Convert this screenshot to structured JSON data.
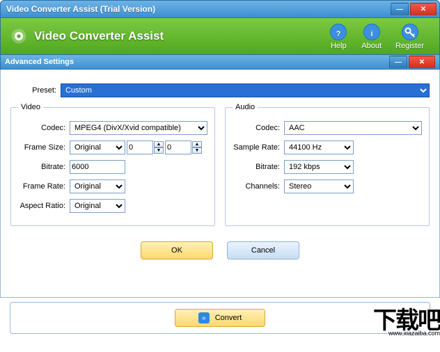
{
  "window": {
    "title": "Video Converter Assist (Trial Version)"
  },
  "brand": {
    "title": "Video Converter Assist"
  },
  "toolbar": {
    "help": "Help",
    "about": "About",
    "register": "Register"
  },
  "dialog": {
    "title": "Advanced Settings",
    "preset_label": "Preset:",
    "preset_value": "Custom",
    "video": {
      "legend": "Video",
      "codec_label": "Codec:",
      "codec_value": "MPEG4 (DivX/Xvid compatible)",
      "framesize_label": "Frame Size:",
      "framesize_value": "Original",
      "width": "0",
      "height": "0",
      "bitrate_label": "Bitrate:",
      "bitrate_value": "6000",
      "framerate_label": "Frame Rate:",
      "framerate_value": "Original",
      "aspect_label": "Aspect Ratio:",
      "aspect_value": "Original"
    },
    "audio": {
      "legend": "Audio",
      "codec_label": "Codec:",
      "codec_value": "AAC",
      "samplerate_label": "Sample Rate:",
      "samplerate_value": "44100 Hz",
      "bitrate_label": "Bitrate:",
      "bitrate_value": "192 kbps",
      "channels_label": "Channels:",
      "channels_value": "Stereo"
    },
    "ok": "OK",
    "cancel": "Cancel"
  },
  "footer": {
    "convert": "Convert"
  },
  "watermark": {
    "big": "下载吧",
    "url": "www.xiazaiba.com"
  }
}
